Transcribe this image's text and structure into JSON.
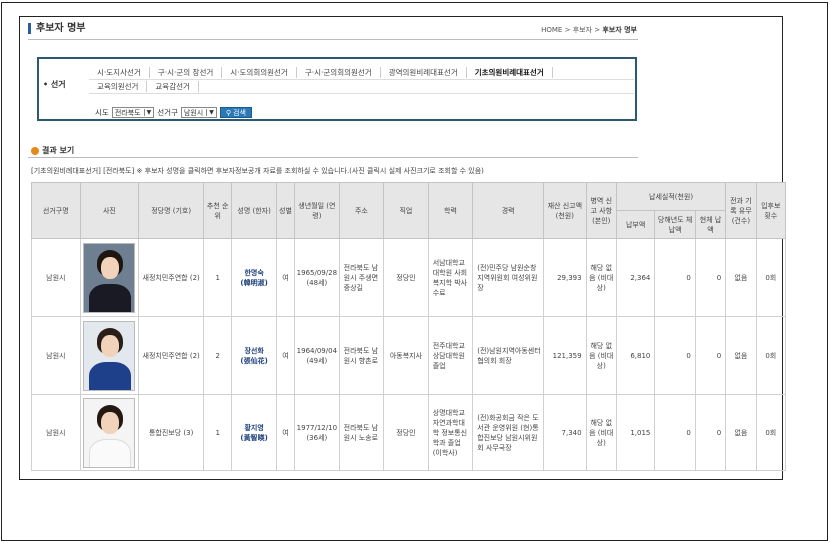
{
  "header": {
    "title": "후보자 명부",
    "breadcrumb": [
      "HOME",
      "후보자",
      "후보자 명부"
    ],
    "breadcrumb_sep": ">"
  },
  "election_filter": {
    "label": "선거",
    "bullet": "•",
    "tabs_row1": [
      "시·도지사선거",
      "구·시·군의 장선거",
      "시·도의회의원선거",
      "구·시·군의회의원선거",
      "광역의원비례대표선거",
      "기초의원비례대표선거"
    ],
    "tabs_row2": [
      "교육의원선거",
      "교육감선거"
    ],
    "active_tab": "기초의원비례대표선거",
    "sido_label": "시도",
    "sido_value": "전라북도",
    "district_label": "선거구",
    "district_value": "남원시",
    "search_button": "검색"
  },
  "results": {
    "heading": "결과 보기",
    "note": "[기초의원비례대표선거] [전라북도] ※ 후보자 성명을 클릭하면 후보자정보공개 자료를 조회하실 수 있습니다.(사진 클릭시 실제 사진크기로 조회할 수 있음)",
    "columns": {
      "district": "선거구명",
      "photo": "사진",
      "party": "정당명 (기호)",
      "rank": "추천 순위",
      "name": "성명 (한자)",
      "gender": "성별",
      "birth": "생년월일 (연령)",
      "address": "주소",
      "job": "직업",
      "education": "학력",
      "career": "경력",
      "assets": "재산 신고액 (천원)",
      "military": "병역 신고 사항 (본인)",
      "tax_group": "납세실적(천원)",
      "tax_paid": "납부액",
      "tax_arrears_year": "당해년도 체납액",
      "tax_current_arrears": "현체 납액",
      "criminal": "전과 기록 유무 (건수)",
      "candidacy": "입후보 횟수"
    },
    "rows": [
      {
        "district": "남원시",
        "party": "새정치민주연합 (2)",
        "rank": "1",
        "name": "한명숙",
        "hanja": "(韓明淑)",
        "gender": "여",
        "birth": "1965/09/28 (48세)",
        "address": "전라북도 남원시 주생면 중상길",
        "job": "정당인",
        "education": "서남대학교대학원 사회복지학 박사 수료",
        "career": "(전)민주당 남원순창지역위원회 여성위원장",
        "assets": "29,393",
        "military": "해당 없음 (비대상)",
        "tax_paid": "2,364",
        "tax_arrears_year": "0",
        "tax_current_arrears": "0",
        "criminal": "없음",
        "candidacy": "0회"
      },
      {
        "district": "남원시",
        "party": "새정치민주연합 (2)",
        "rank": "2",
        "name": "장선화",
        "hanja": "(張仙花)",
        "gender": "여",
        "birth": "1964/09/04 (49세)",
        "address": "전라북도 남원시 향촌로",
        "job": "아동복지사",
        "education": "전주대학교 상담대학원 졸업",
        "career": "(전)남원지역아동센터협의회 회장",
        "assets": "121,359",
        "military": "해당 없음 (비대상)",
        "tax_paid": "6,810",
        "tax_arrears_year": "0",
        "tax_current_arrears": "0",
        "criminal": "없음",
        "candidacy": "0회"
      },
      {
        "district": "남원시",
        "party": "통합진보당 (3)",
        "rank": "1",
        "name": "황지영",
        "hanja": "(黃智暎)",
        "gender": "여",
        "birth": "1977/12/10 (36세)",
        "address": "전라북도 남원시 노송로",
        "job": "정당인",
        "education": "상명대학교 자연과학대학 정보통신학과 졸업 (이학사)",
        "career": "(전)화공회금 작은 도서관 운영위원 (현)통합진보당 남원시위원회 사무국장",
        "assets": "7,340",
        "military": "해당 없음 (비대상)",
        "tax_paid": "1,015",
        "tax_arrears_year": "0",
        "tax_current_arrears": "0",
        "criminal": "없음",
        "candidacy": "0회"
      }
    ]
  }
}
